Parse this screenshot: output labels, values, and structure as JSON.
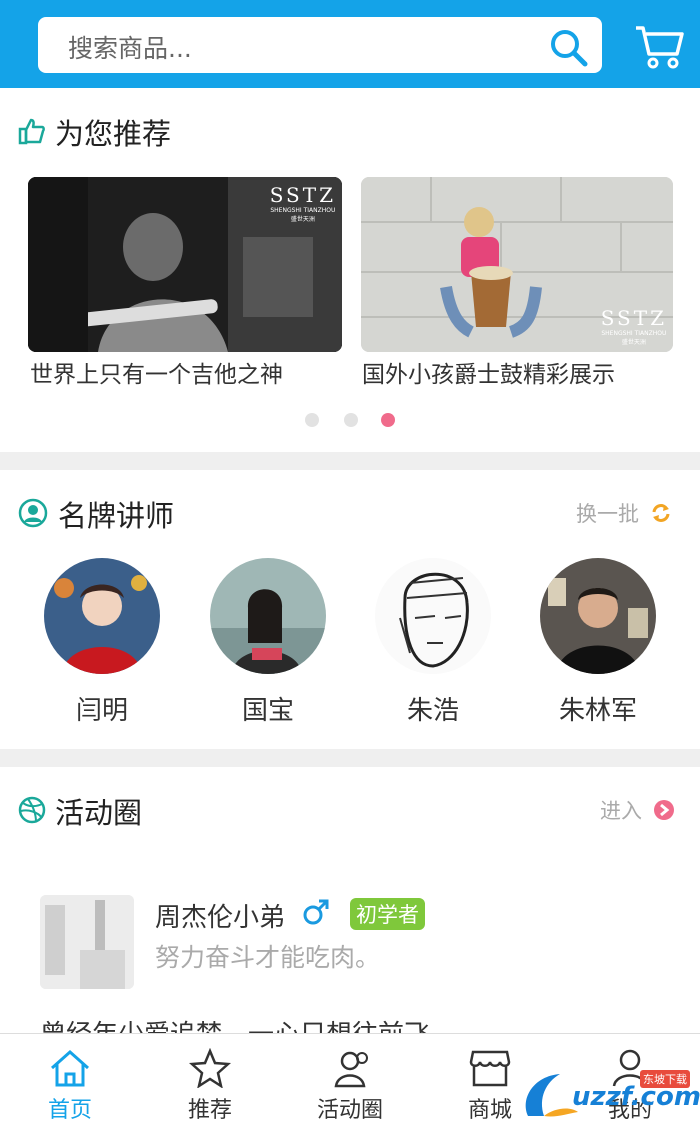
{
  "search": {
    "placeholder": "搜索商品..."
  },
  "recommend": {
    "title": "为您推荐",
    "items": [
      {
        "caption": "世界上只有一个吉他之神",
        "watermark": "SSTZ",
        "watermark_sub": "SHENGSHI TIANZHOU",
        "watermark_cn": "盛世天洲"
      },
      {
        "caption": "国外小孩爵士鼓精彩展示",
        "watermark": "SSTZ",
        "watermark_sub": "SHENGSHI TIANZHOU",
        "watermark_cn": "盛世天洲"
      }
    ],
    "active_dot": 2
  },
  "teachers": {
    "title": "名牌讲师",
    "action": "换一批",
    "names": [
      "闫明",
      "国宝",
      "朱浩",
      "朱林军"
    ]
  },
  "activity": {
    "title": "活动圈",
    "action": "进入",
    "post": {
      "user": "周杰伦小弟",
      "badge": "初学者",
      "bio": "努力奋斗才能吃肉。",
      "content": "曾经年少爱追梦，一心只想往前飞"
    }
  },
  "tabs": [
    "首页",
    "推荐",
    "活动圈",
    "商城",
    "我的"
  ],
  "colors": {
    "primary": "#14a3e8",
    "accent": "#1aa89a",
    "pink": "#f06b8b",
    "badge": "#7fc83b"
  },
  "watermark": {
    "text": "uzzf.com",
    "sub": "东坡下载"
  }
}
